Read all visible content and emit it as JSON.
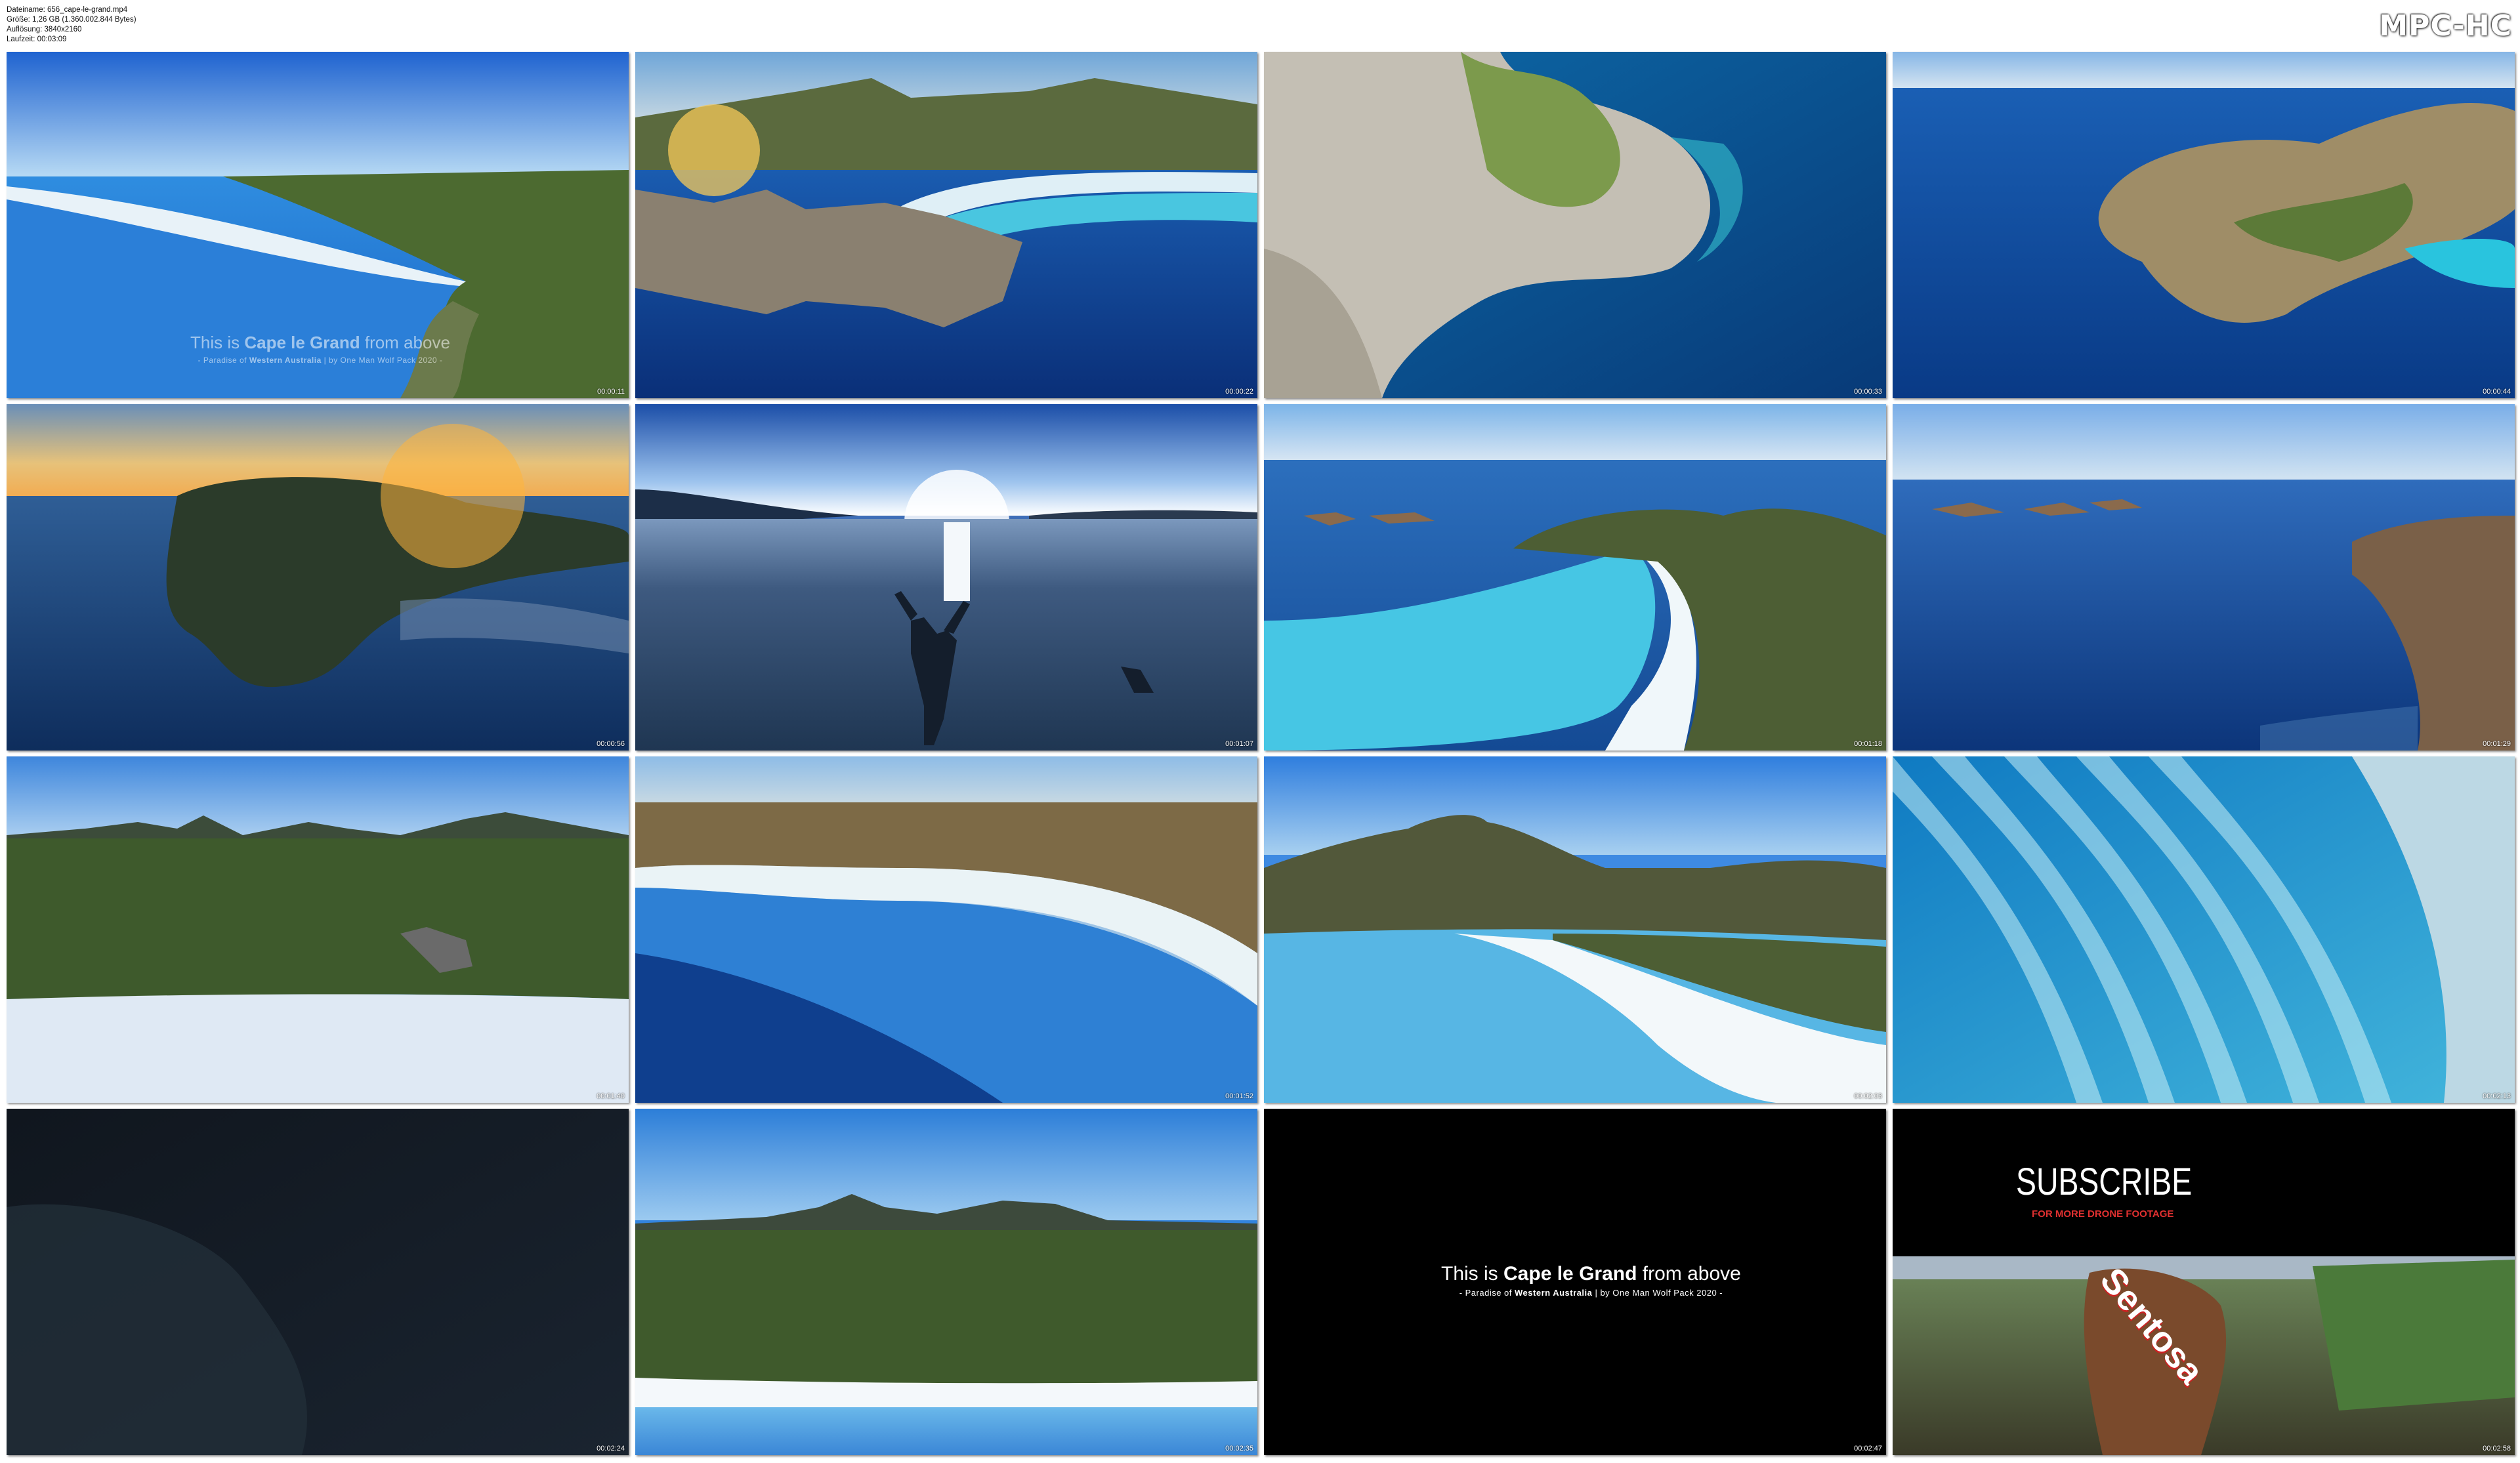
{
  "file_info": {
    "filename": "Dateiname: 656_cape-le-grand.mp4",
    "size": "Größe: 1,26 GB (1.360.002.844 Bytes)",
    "resolution": "Auflösung: 3840x2160",
    "duration": "Laufzeit: 00:03:09"
  },
  "brand": "MPC-HC",
  "thumbnails": [
    {
      "timestamp": "00:00:11",
      "scene": "coast-beach",
      "sky": "#2e74d8",
      "sea": "#1e7fd6",
      "land": "#4f6d2c"
    },
    {
      "timestamp": "00:00:22",
      "scene": "bay-sunflare",
      "sky": "#7eb2dc",
      "sea": "#0f3f8e",
      "land": "#5d6a3c"
    },
    {
      "timestamp": "00:00:33",
      "scene": "rocky-topdown",
      "sky": "#0d4b8a",
      "sea": "#0d4b8a",
      "land": "#bdb7a8"
    },
    {
      "timestamp": "00:00:44",
      "scene": "island",
      "sky": "#8fb8e0",
      "sea": "#0d4ea0",
      "land": "#9f8d67"
    },
    {
      "timestamp": "00:00:56",
      "scene": "sunset-headland",
      "sky": "#f0b45a",
      "sea": "#113b74",
      "land": "#2b3b2a"
    },
    {
      "timestamp": "00:01:07",
      "scene": "silhouette",
      "sky": "#3f6fb8",
      "sea": "#3b5578",
      "land": "#2a3e58"
    },
    {
      "timestamp": "00:01:18",
      "scene": "white-beach",
      "sky": "#7eb4e8",
      "sea": "#2a86d8",
      "land": "#4d5e34"
    },
    {
      "timestamp": "00:01:29",
      "scene": "ocean-islands",
      "sky": "#80b0e6",
      "sea": "#1a4f9a",
      "land": "#7a6048"
    },
    {
      "timestamp": "00:01:40",
      "scene": "green-land",
      "sky": "#4b8fdc",
      "sea": "#dfe9f4",
      "land": "#3e5a2c"
    },
    {
      "timestamp": "00:01:52",
      "scene": "curved-bay",
      "sky": "#9ec4e6",
      "sea": "#1e66c6",
      "land": "#837048"
    },
    {
      "timestamp": "00:02:03",
      "scene": "mountain-beach",
      "sky": "#3e8ae2",
      "sea": "#5ab8e6",
      "land": "#4d5e34"
    },
    {
      "timestamp": "00:02:13",
      "scene": "waves-topdown",
      "sky": "#167fc0",
      "sea": "#167fc0",
      "land": "#bcd8e4"
    },
    {
      "timestamp": "00:02:24",
      "scene": "dark",
      "sky": "#141c24",
      "sea": "#141c24",
      "land": "#1c2830"
    },
    {
      "timestamp": "00:02:35",
      "scene": "beach-front",
      "sky": "#3384de",
      "sea": "#5aa6e4",
      "land": "#3f5a2c"
    },
    {
      "timestamp": "00:02:47",
      "scene": "title-card",
      "sky": "#000000",
      "sea": "#000000",
      "land": "#000000"
    },
    {
      "timestamp": "00:02:58",
      "scene": "subscribe",
      "sky": "#000000",
      "sea": "#000000",
      "land": "#4a3a2a"
    }
  ],
  "overlay_title": {
    "this_is": "This is",
    "place": "Cape le Grand",
    "from": "from above",
    "subtitle_a": "- Paradise of",
    "subtitle_b": "Western Australia",
    "subtitle_c": "| by One Man Wolf Pack 2020 -"
  },
  "subscribe": {
    "headline": "SUBSCRIBE",
    "tagline": "FOR MORE DRONE FOOTAGE",
    "sign_text": "Sentosa"
  }
}
